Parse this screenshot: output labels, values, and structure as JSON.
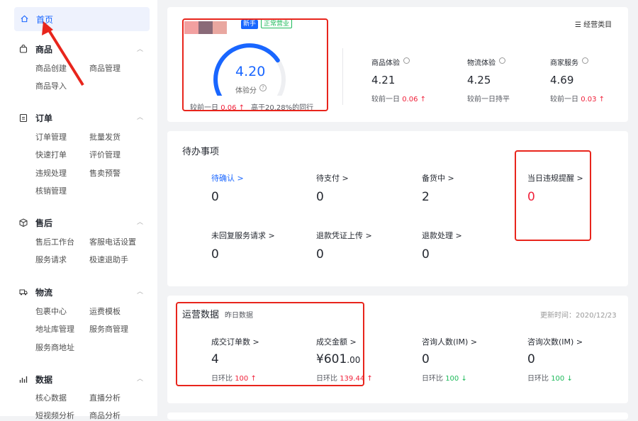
{
  "sidebar": {
    "home": "首页",
    "sections": [
      {
        "title": "商品",
        "icon": "bag-icon",
        "items": [
          "商品创建",
          "商品管理",
          "商品导入"
        ]
      },
      {
        "title": "订单",
        "icon": "clipboard-icon",
        "items": [
          "订单管理",
          "批量发货",
          "快速打单",
          "评价管理",
          "违规处理",
          "售卖预警",
          "核销管理"
        ]
      },
      {
        "title": "售后",
        "icon": "box-icon",
        "items": [
          "售后工作台",
          "客服电话设置",
          "服务请求",
          "极速退助手"
        ]
      },
      {
        "title": "物流",
        "icon": "truck-icon",
        "items": [
          "包裹中心",
          "运费模板",
          "地址库管理",
          "服务商管理",
          "服务商地址"
        ]
      },
      {
        "title": "数据",
        "icon": "chart-icon",
        "items": [
          "核心数据",
          "直播分析",
          "短视频分析",
          "商品分析"
        ]
      }
    ]
  },
  "score": {
    "badge_new": "新手",
    "badge_status": "正常营业",
    "value": "4.20",
    "label": "体验分",
    "help": "?",
    "compare_prefix": "较前一日",
    "compare_value": "0.06",
    "arrow_up": "↑",
    "higher_than": "高于20.28%的同行",
    "category_link": "经营类目",
    "score_ratio": 0.7,
    "metrics": [
      {
        "label": "商品体验",
        "value": "4.21",
        "note": "较前一日",
        "note_value": "0.06",
        "arrow": "↑"
      },
      {
        "label": "物流体验",
        "value": "4.25",
        "note": "较前一日持平",
        "note_value": "",
        "arrow": ""
      },
      {
        "label": "商家服务",
        "value": "4.69",
        "note": "较前一日",
        "note_value": "0.03",
        "arrow": "↑"
      }
    ]
  },
  "todo": {
    "title": "待办事项",
    "items": [
      {
        "label": "待确认 >",
        "value": "0"
      },
      {
        "label": "待支付 >",
        "value": "0"
      },
      {
        "label": "备货中 >",
        "value": "2"
      },
      {
        "label": "当日违规提醒 >",
        "value": "0"
      },
      {
        "label": "未回复服务请求 >",
        "value": "0"
      },
      {
        "label": "退款凭证上传 >",
        "value": "0"
      },
      {
        "label": "退款处理 >",
        "value": "0"
      }
    ]
  },
  "ops": {
    "title": "运营数据",
    "subtitle": "昨日数据",
    "updated": "更新时间：2020/12/23",
    "metrics": [
      {
        "label": "成交订单数 >",
        "value": "4",
        "value_suffix": "",
        "ratio_label": "日环比",
        "ratio": "100",
        "arrow": "↑",
        "dir": "up"
      },
      {
        "label": "成交金额 >",
        "value": "¥601",
        "value_suffix": ".00",
        "ratio_label": "日环比",
        "ratio": "139.44",
        "arrow": "↑",
        "dir": "up"
      },
      {
        "label": "咨询人数(IM) >",
        "value": "0",
        "value_suffix": "",
        "ratio_label": "日环比",
        "ratio": "100",
        "arrow": "↓",
        "dir": "down"
      },
      {
        "label": "咨询次数(IM) >",
        "value": "0",
        "value_suffix": "",
        "ratio_label": "日环比",
        "ratio": "100",
        "arrow": "↓",
        "dir": "down"
      }
    ]
  },
  "colors": {
    "accent": "#1966ff",
    "red": "#f0213a",
    "green": "#1dba5a",
    "annotation": "#e8251c"
  }
}
